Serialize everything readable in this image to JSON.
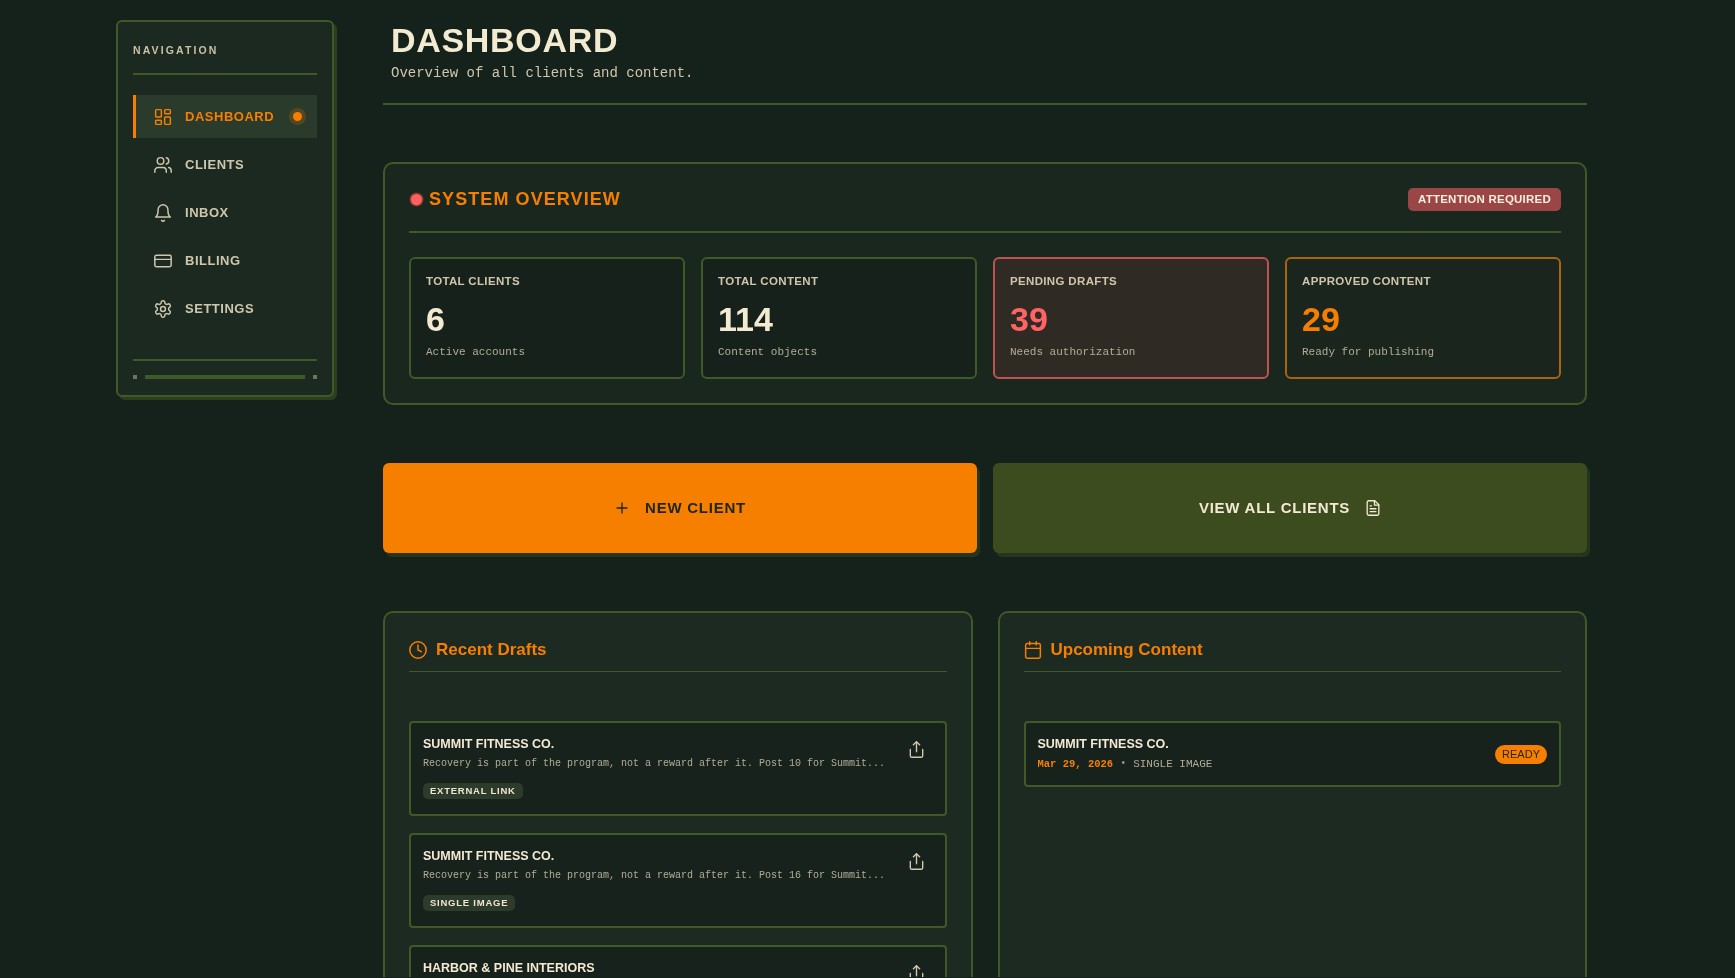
{
  "sidebar": {
    "heading": "NAVIGATION",
    "items": [
      {
        "label": "DASHBOARD",
        "selected": true
      },
      {
        "label": "CLIENTS",
        "selected": false
      },
      {
        "label": "INBOX",
        "selected": false
      },
      {
        "label": "BILLING",
        "selected": false
      },
      {
        "label": "SETTINGS",
        "selected": false
      }
    ]
  },
  "header": {
    "title": "DASHBOARD",
    "subtitle": "Overview of all clients and content."
  },
  "system_overview": {
    "title": "SYSTEM OVERVIEW",
    "badge": "ATTENTION REQUIRED",
    "stats": [
      {
        "kind": "neutral",
        "label": "TOTAL CLIENTS",
        "value": "6",
        "caption": "Active accounts"
      },
      {
        "kind": "neutral",
        "label": "TOTAL CONTENT",
        "value": "114",
        "caption": "Content objects"
      },
      {
        "kind": "alert",
        "label": "PENDING DRAFTS",
        "value": "39",
        "caption": "Needs authorization"
      },
      {
        "kind": "success",
        "label": "APPROVED CONTENT",
        "value": "29",
        "caption": "Ready for publishing"
      }
    ]
  },
  "actions": [
    {
      "kind": "primary",
      "label": "NEW CLIENT"
    },
    {
      "kind": "secondary",
      "label": "VIEW ALL CLIENTS"
    }
  ],
  "recent_drafts": {
    "title": "Recent Drafts",
    "items": [
      {
        "client": "SUMMIT FITNESS CO.",
        "excerpt": "Recovery is part of the program, not a reward after it. Post 10 for Summit...",
        "tag": "EXTERNAL LINK"
      },
      {
        "client": "SUMMIT FITNESS CO.",
        "excerpt": "Recovery is part of the program, not a reward after it. Post 16 for Summit...",
        "tag": "SINGLE IMAGE"
      },
      {
        "client": "HARBOR & PINE INTERIORS"
      }
    ]
  },
  "upcoming_content": {
    "title": "Upcoming Content",
    "items": [
      {
        "client": "SUMMIT FITNESS CO.",
        "date": "Mar 29, 2026",
        "separator": "•",
        "type": "SINGLE IMAGE",
        "status": "READY"
      }
    ]
  }
}
